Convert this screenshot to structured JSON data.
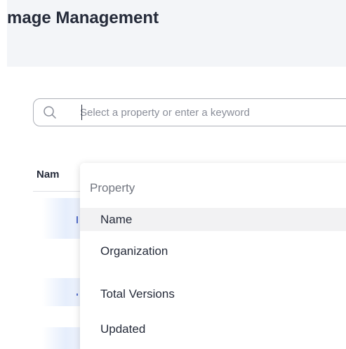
{
  "page": {
    "title": "mage Management"
  },
  "search": {
    "placeholder": "Select a property or enter a keyword"
  },
  "table": {
    "columns": [
      "Nam"
    ]
  },
  "dropdown": {
    "heading": "Property",
    "items": [
      {
        "label": "Name"
      },
      {
        "label": "Organization"
      },
      {
        "label": "Total Versions"
      },
      {
        "label": "Updated"
      }
    ]
  },
  "colors": {
    "accent": "#526ecc",
    "text": "#252b3a",
    "muted": "#71757f",
    "header_bg": "#f3f5f8",
    "hover_bg": "#f2f2f3"
  },
  "icons": {
    "search": "search-icon"
  }
}
